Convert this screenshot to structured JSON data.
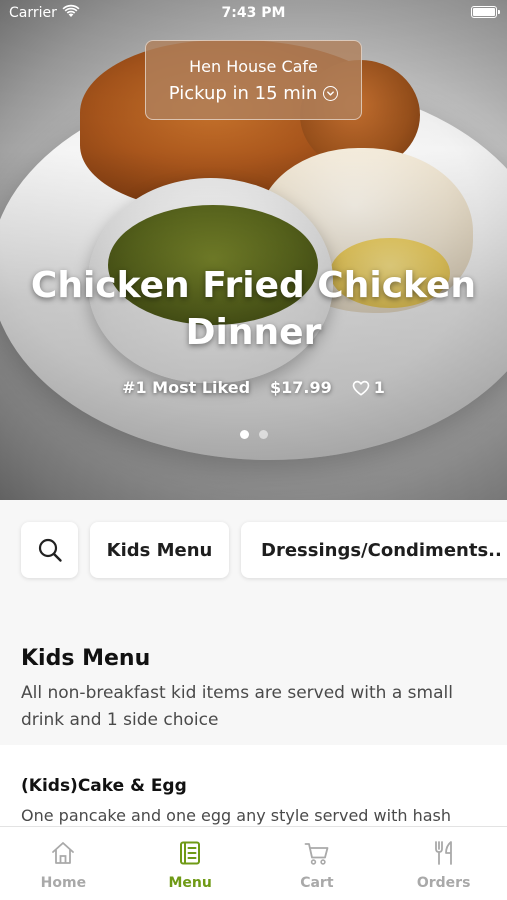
{
  "status_bar": {
    "carrier": "Carrier",
    "time": "7:43 PM"
  },
  "store": {
    "name": "Hen House Cafe",
    "pickup": "Pickup in 15 min",
    "icon": "chevron-down-circle-icon"
  },
  "hero": {
    "title": "Chicken Fried Chicken Dinner",
    "rank": "#1 Most Liked",
    "price": "$17.99",
    "like_count": "1",
    "pagination": {
      "total": 2,
      "active_index": 0
    }
  },
  "categories": {
    "search_icon": "search-icon",
    "items": [
      "Kids Menu",
      "Dressings/Condiments.."
    ]
  },
  "section": {
    "title": "Kids Menu",
    "description": "All non-breakfast kid items are served with a small drink and 1 side choice"
  },
  "items": [
    {
      "title": "(Kids)Cake & Egg",
      "description": "One pancake and one egg any style served with hash"
    }
  ],
  "tab_bar": {
    "active": "Menu",
    "tabs": [
      {
        "label": "Home",
        "icon": "home-icon"
      },
      {
        "label": "Menu",
        "icon": "menu-icon"
      },
      {
        "label": "Cart",
        "icon": "cart-icon"
      },
      {
        "label": "Orders",
        "icon": "orders-icon"
      }
    ]
  },
  "colors": {
    "accent": "#6f9a16",
    "inactive_tab": "#a9a9a9",
    "store_pill": "#b0805c"
  }
}
